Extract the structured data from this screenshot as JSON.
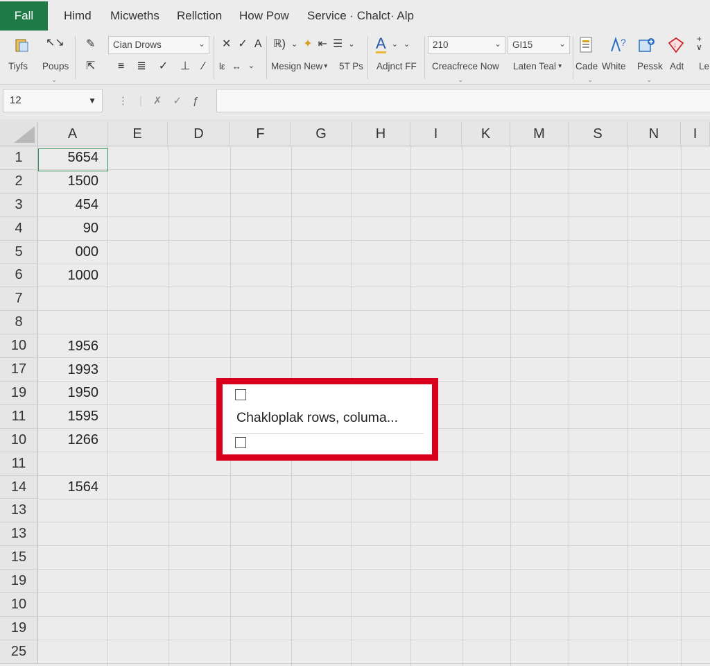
{
  "menubar": {
    "file_label": "Fall",
    "items": [
      "Himd",
      "Micweths",
      "Rellction",
      "How Pow",
      "Service · Chalct· Alp"
    ]
  },
  "ribbon": {
    "font_name": "Cian Drows",
    "font_size": "210",
    "number_format": "GI15",
    "labels": {
      "styles": "Tiyfs",
      "poups": "Poups",
      "merge": "Mesign New",
      "pct": "5T Ps",
      "adjust": "Adjnct FF",
      "conditional": "Creacfrece Now",
      "latest": "Laten Teal",
      "code": "Cade",
      "white": "White",
      "paste": "Pessk",
      "add": "Adt",
      "le": "Le"
    },
    "small": {
      "formula_lc": "lε",
      "arrow_lr": "↔"
    }
  },
  "formula_bar": {
    "name_box": "12",
    "formula_value": ""
  },
  "columns": [
    "A",
    "E",
    "D",
    "F",
    "G",
    "H",
    "I",
    "K",
    "M",
    "S",
    "N",
    "I"
  ],
  "rows": [
    {
      "num": "1",
      "a": "5654"
    },
    {
      "num": "2",
      "a": "1500"
    },
    {
      "num": "3",
      "a": "454"
    },
    {
      "num": "4",
      "a": "90"
    },
    {
      "num": "5",
      "a": "000"
    },
    {
      "num": "6",
      "a": "1000"
    },
    {
      "num": "7",
      "a": ""
    },
    {
      "num": "8",
      "a": ""
    },
    {
      "num": "10",
      "a": "1956"
    },
    {
      "num": "17",
      "a": "1993"
    },
    {
      "num": "19",
      "a": "1950"
    },
    {
      "num": "11",
      "a": "1595"
    },
    {
      "num": "10",
      "a": "1266"
    },
    {
      "num": "11",
      "a": ""
    },
    {
      "num": "14",
      "a": "1564"
    },
    {
      "num": "13",
      "a": ""
    },
    {
      "num": "13",
      "a": ""
    },
    {
      "num": "15",
      "a": ""
    },
    {
      "num": "19",
      "a": ""
    },
    {
      "num": "10",
      "a": ""
    },
    {
      "num": "19",
      "a": ""
    },
    {
      "num": "25",
      "a": ""
    }
  ],
  "popup": {
    "text": "Chakloplak rows, columa..."
  },
  "colors": {
    "file_tab": "#1e7a46",
    "popup_border": "#d9001b",
    "selection": "#2f8f5b"
  }
}
